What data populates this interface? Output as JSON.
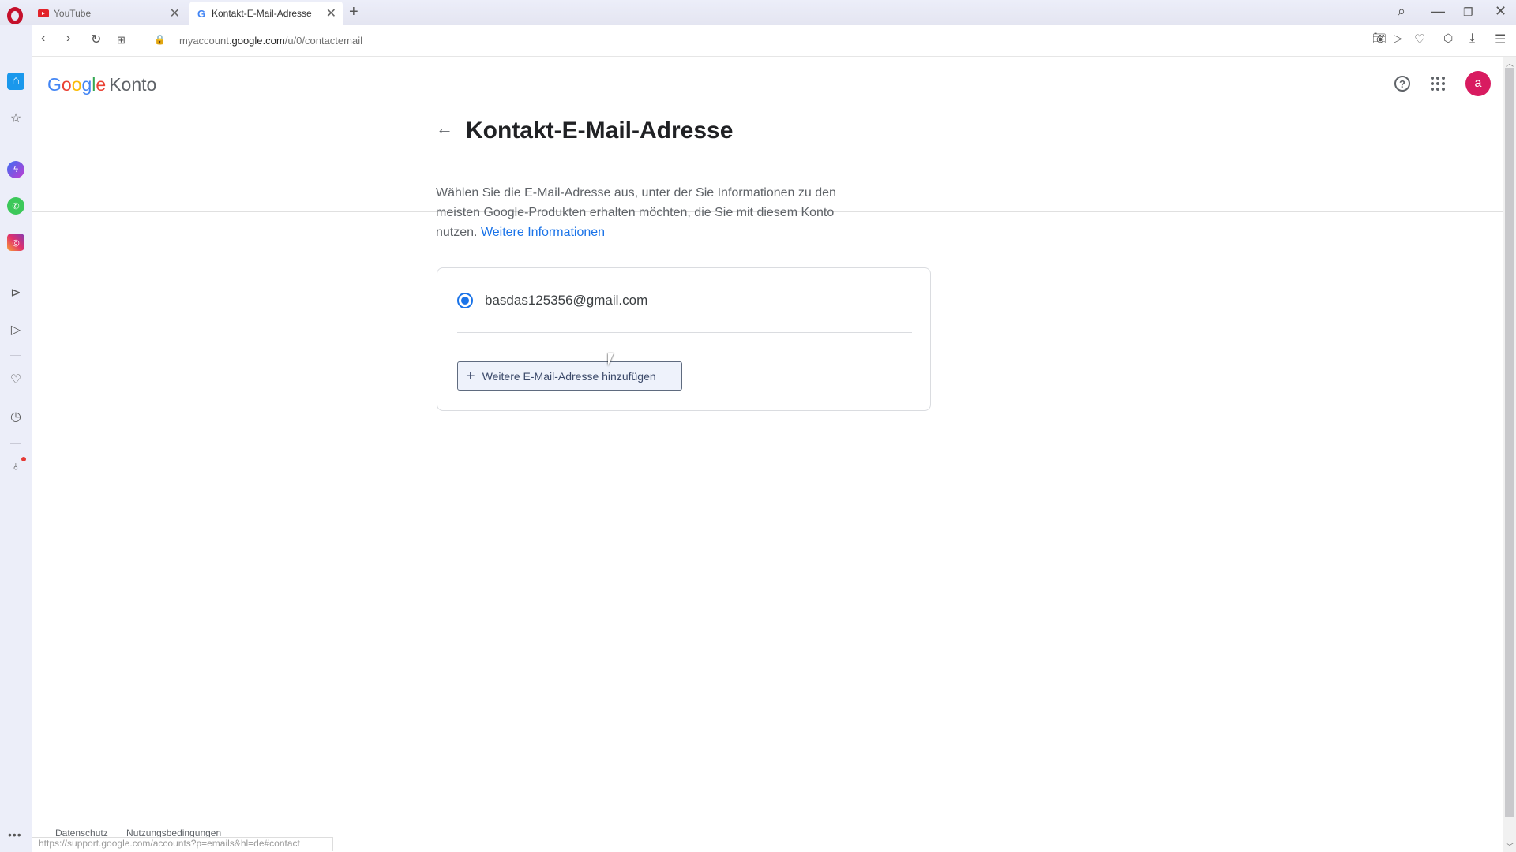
{
  "browser": {
    "tabs": [
      {
        "label": "YouTube",
        "icon": "youtube-icon",
        "active": false
      },
      {
        "label": "Kontakt-E-Mail-Adresse",
        "icon": "google-icon",
        "active": true
      }
    ],
    "new_tab_label": "+",
    "url_prefix": "myaccount.",
    "url_domain": "google.com",
    "url_path": "/u/0/contactemail",
    "status_url": "https://support.google.com/accounts?p=emails&hl=de#contact"
  },
  "sidebar": {
    "items": [
      "home-icon",
      "star-icon",
      "messenger-icon",
      "whatsapp-icon",
      "instagram-icon",
      "player-icon",
      "send-icon",
      "heart-icon",
      "history-icon",
      "tips-icon"
    ],
    "more_label": "•••"
  },
  "header": {
    "logo": [
      "G",
      "o",
      "o",
      "g",
      "l",
      "e"
    ],
    "product": "Konto",
    "avatar_letter": "a",
    "avatar_color": "#d81b60"
  },
  "main": {
    "title": "Kontakt-E-Mail-Adresse",
    "description": "Wählen Sie die E-Mail-Adresse aus, unter der Sie Informationen zu den meisten Google-Produkten erhalten möchten, die Sie mit diesem Konto nutzen.",
    "learn_more": "Weitere Informationen",
    "email": "basdas125356@gmail.com",
    "email_selected": true,
    "add_button": "Weitere E-Mail-Adresse hinzufügen"
  },
  "footer": {
    "privacy": "Datenschutz",
    "terms": "Nutzungsbedingungen"
  },
  "colors": {
    "accent": "#1a73e8",
    "opera_red": "#c5102b"
  }
}
